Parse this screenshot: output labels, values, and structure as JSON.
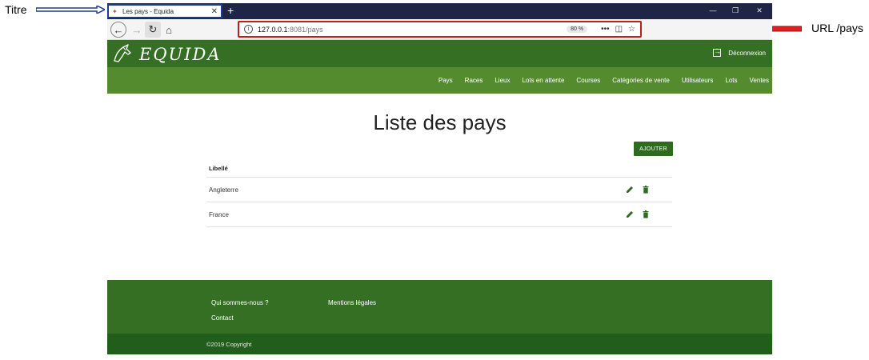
{
  "annotations": {
    "left_label": "Titre",
    "right_label": "URL /pays"
  },
  "browser": {
    "tab_title": "Les pays - Equida",
    "url_host": "127.0.0.1",
    "url_rest": ":8081/pays",
    "zoom": "80 %"
  },
  "site": {
    "logo_text": "EQUIDA",
    "logout_label": "Déconnexion",
    "nav": [
      "Pays",
      "Races",
      "Lieux",
      "Lots en attente",
      "Courses",
      "Catégories de vente",
      "Utilisateurs",
      "Lots",
      "Ventes"
    ]
  },
  "main": {
    "title": "Liste des pays",
    "add_label": "AJOUTER",
    "column_header": "Libellé",
    "rows": [
      "Angleterre",
      "France"
    ]
  },
  "footer": {
    "about": "Qui sommes-nous ?",
    "legal": "Mentions légales",
    "contact": "Contact",
    "copyright": "©2019 Copyright"
  },
  "colors": {
    "header_dark": "#346f23",
    "nav_green": "#548b2e",
    "button_green": "#2e6b20",
    "url_border": "#c01d1d",
    "tab_border": "#1d3d8a"
  }
}
